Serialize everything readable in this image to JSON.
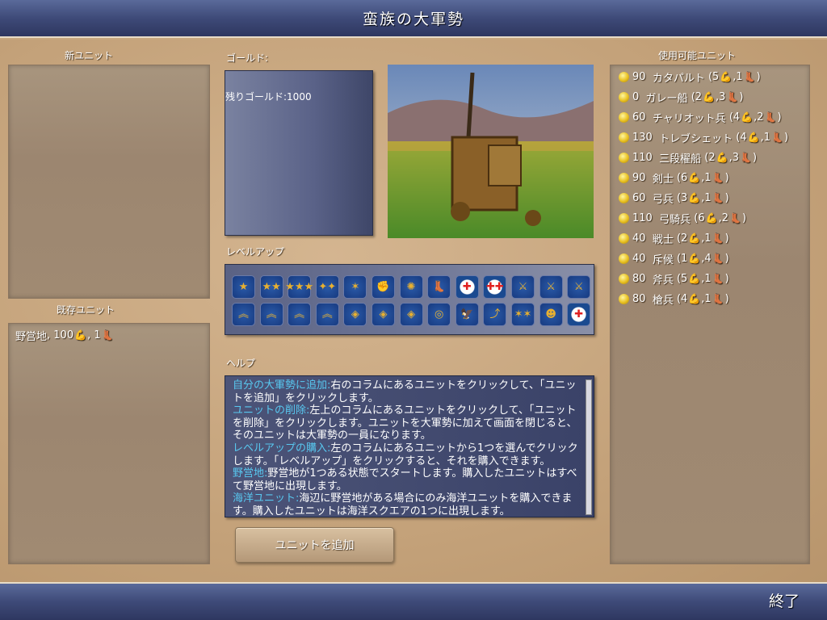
{
  "header": {
    "title": "蛮族の大軍勢"
  },
  "footer": {
    "quit_label": "終了"
  },
  "left": {
    "new_units_label": "新ユニット",
    "existing_units_label": "既存ユニット",
    "existing_units": [
      {
        "name": "野営地",
        "cost": "100",
        "attack": "1",
        "move": "1"
      }
    ]
  },
  "gold": {
    "label": "ゴールド:",
    "remaining": "残りゴールド:1000"
  },
  "levelup": {
    "label": "レベルアップ",
    "icons": [
      [
        "star-1",
        "★"
      ],
      [
        "star-2",
        "★★"
      ],
      [
        "star-3",
        "★★★"
      ],
      [
        "star-4",
        "✦✦"
      ],
      [
        "star-5",
        "✶"
      ],
      [
        "fist",
        "✊"
      ],
      [
        "burst",
        "✺"
      ],
      [
        "boot-plus",
        "👢"
      ],
      [
        "medic",
        "✚"
      ],
      [
        "medic-2",
        "✚✚"
      ],
      [
        "swords-1",
        "⚔"
      ],
      [
        "swords-2",
        "⚔"
      ],
      [
        "swords-3",
        "⚔"
      ],
      [
        "chevron-1",
        "︽"
      ],
      [
        "chevron-2",
        "︽"
      ],
      [
        "chevron-3",
        "︽"
      ],
      [
        "chevron-4",
        "︽"
      ],
      [
        "diamond-1",
        "◈"
      ],
      [
        "diamond-2",
        "◈"
      ],
      [
        "diamond-3",
        "◈"
      ],
      [
        "target",
        "◎"
      ],
      [
        "eagle",
        "🦅"
      ],
      [
        "path",
        "⤴"
      ],
      [
        "stars-6",
        "✶✶"
      ],
      [
        "face",
        "☻"
      ],
      [
        "medic-3",
        "✚"
      ]
    ]
  },
  "help": {
    "label": "ヘルプ",
    "entries": [
      {
        "head": "自分の大軍勢に追加:",
        "body": "右のコラムにあるユニットをクリックして、「ユニットを追加」をクリックします。"
      },
      {
        "head": "ユニットの削除:",
        "body": "左上のコラムにあるユニットをクリックして、「ユニットを削除」をクリックします。ユニットを大軍勢に加えて画面を閉じると、そのユニットは大軍勢の一員になります。"
      },
      {
        "head": "レベルアップの購入:",
        "body": "左のコラムにあるユニットから1つを選んでクリックします。「レベルアップ」をクリックすると、それを購入できます。"
      },
      {
        "head": "野営地:",
        "body": "野営地が1つある状態でスタートします。購入したユニットはすべて野営地に出現します。"
      },
      {
        "head": "海洋ユニット:",
        "body": "海辺に野営地がある場合にのみ海洋ユニットを購入できます。購入したユニットは海洋スクエアの1つに出現します。"
      }
    ]
  },
  "add_button": "ユニットを追加",
  "available": {
    "label": "使用可能ユニット",
    "units": [
      {
        "cost": "90",
        "name": "カタパルト",
        "attack": "5",
        "move": "1"
      },
      {
        "cost": "0",
        "name": "ガレー船",
        "attack": "2",
        "move": "3"
      },
      {
        "cost": "60",
        "name": "チャリオット兵",
        "attack": "4",
        "move": "2"
      },
      {
        "cost": "130",
        "name": "トレブシェット",
        "attack": "4",
        "move": "1"
      },
      {
        "cost": "110",
        "name": "三段櫂船",
        "attack": "2",
        "move": "3"
      },
      {
        "cost": "90",
        "name": "剣士",
        "attack": "6",
        "move": "1"
      },
      {
        "cost": "60",
        "name": "弓兵",
        "attack": "3",
        "move": "1"
      },
      {
        "cost": "110",
        "name": "弓騎兵",
        "attack": "6",
        "move": "2"
      },
      {
        "cost": "40",
        "name": "戦士",
        "attack": "2",
        "move": "1"
      },
      {
        "cost": "40",
        "name": "斥候",
        "attack": "1",
        "move": "4"
      },
      {
        "cost": "80",
        "name": "斧兵",
        "attack": "5",
        "move": "1"
      },
      {
        "cost": "80",
        "name": "槍兵",
        "attack": "4",
        "move": "1"
      }
    ]
  },
  "colors": {
    "help_heading": "#58c8f0",
    "header": "#3e4a78",
    "parchment": "#c8a880"
  }
}
